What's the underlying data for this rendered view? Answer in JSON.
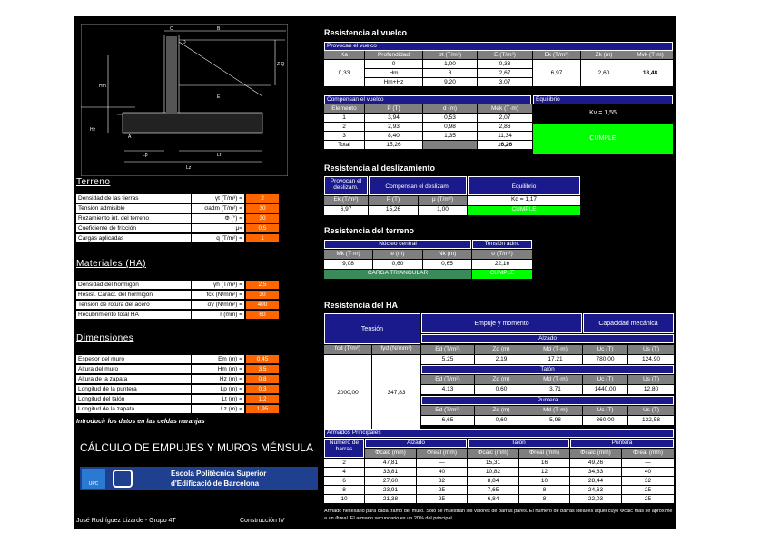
{
  "drawing": {
    "labels": {
      "c": "C",
      "b": "B",
      "a": "A",
      "d": "D",
      "e": "E",
      "hm": "Hm",
      "zq": "Z Q",
      "hz": "Hz",
      "lp": "Lp",
      "lt": "Lt",
      "lz": "Lz"
    }
  },
  "terreno": {
    "title": "Terreno",
    "rows": [
      {
        "label": "Densidad de las tierras",
        "symbol": "γt (T/m³) =",
        "value": "2"
      },
      {
        "label": "Tensión admisible",
        "symbol": "σadm (T/m²) =",
        "value": "30"
      },
      {
        "label": "Rozamiento int. del terreno",
        "symbol": "Φ (°) =",
        "value": "30"
      },
      {
        "label": "Coeficiente de fricción",
        "symbol": "μ=",
        "value": "0,5"
      },
      {
        "label": "Cargas aplicadas",
        "symbol": "q (T/m²) =",
        "value": "1"
      }
    ]
  },
  "materiales": {
    "title": "Materiales (HA)",
    "rows": [
      {
        "label": "Densidad del hormigón",
        "symbol": "γh (T/m³) =",
        "value": "2,5"
      },
      {
        "label": "Resist. Caract. del hormigón",
        "symbol": "fck (N/mm²) =",
        "value": "30"
      },
      {
        "label": "Tensión de rotura del acero",
        "symbol": "σy (N/mm²) =",
        "value": "400"
      },
      {
        "label": "Recubrimiento total HA",
        "symbol": "r (mm) =",
        "value": "60"
      }
    ]
  },
  "dimensiones": {
    "title": "Dimensiones",
    "rows": [
      {
        "label": "Espesor del muro",
        "symbol": "Em (m) =",
        "value": "0,45"
      },
      {
        "label": "Altura del muro",
        "symbol": "Hm (m) =",
        "value": "3,5"
      },
      {
        "label": "Altura de la zapata",
        "symbol": "Hz (m) =",
        "value": "0,8"
      },
      {
        "label": "Longitud de la puntera",
        "symbol": "Lp (m) =",
        "value": "0,3"
      },
      {
        "label": "Longitud del talón",
        "symbol": "Lt (m) =",
        "value": "1,2"
      },
      {
        "label": "Longitud de la zapata",
        "symbol": "Lz (m) =",
        "value": "1,95"
      }
    ],
    "note": "Introducir los datos en las celdas naranjas"
  },
  "big_title": "CÁLCULO DE EMPUJES Y MUROS MÉNSULA",
  "logo": {
    "short": "UPC",
    "line1": "Escola Politècnica Superior",
    "line2": "d'Edificació de Barcelona"
  },
  "footer": {
    "author": "José Rodríguez Lizarde - Grupo 4T",
    "course": "Construcción IV"
  },
  "vuelco": {
    "title": "Resistencia al vuelco",
    "provocan": "Provocan el vuelco",
    "h": [
      "Ka",
      "Profundidad",
      "σt (T/m²)",
      "E (T/m²)",
      "Ek (T/m²)",
      "Zk (m)",
      "Mvk (T·m)"
    ],
    "ka": "0,33",
    "rows": [
      [
        "0",
        "1,00",
        "0,33"
      ],
      [
        "Hm",
        "8",
        "2,67"
      ],
      [
        "Hm+Hz",
        "9,20",
        "3,07"
      ]
    ],
    "ek": "6,97",
    "zk": "2,60",
    "mvk": "18,48",
    "compensan": "Compensan el vuelco",
    "equilibrio": "Equilibrio",
    "h2": [
      "Elemento",
      "P (T)",
      "d (m)",
      "Mek (T·m)"
    ],
    "rows2": [
      [
        "1",
        "3,94",
        "0,53",
        "2,07"
      ],
      [
        "2",
        "2,93",
        "0,98",
        "2,86"
      ],
      [
        "3",
        "8,40",
        "1,35",
        "11,34"
      ],
      [
        "Total",
        "15,26",
        "",
        "16,26"
      ]
    ],
    "kv": "Kv = 1,55",
    "cumple": "CUMPLE"
  },
  "deslizamiento": {
    "title": "Resistencia al deslizamiento",
    "h": [
      "Provocan el deslizam.",
      "Compensan el deslizam.",
      "Equilibrio"
    ],
    "sub": [
      "Ek (T/m²)",
      "P (T)",
      "μ (T/m²)"
    ],
    "vals": [
      "6,97",
      "15,26",
      "1,00"
    ],
    "kd": "Kd = 1,17",
    "cumple": "CUMPLE"
  },
  "terreno_res": {
    "title": "Resistencia del terreno",
    "h": [
      "Núcleo central",
      "Tensión adm."
    ],
    "sub": [
      "Mk (T·m)",
      "e (m)",
      "Nk (m)",
      "σ (T/m²)"
    ],
    "vals": [
      "9,08",
      "0,60",
      "0,65",
      "22,16"
    ],
    "carga": "CARGA TRIANGULAR",
    "cumple": "CUMPLE"
  },
  "ha": {
    "title": "Resistencia del HA",
    "tension": "Tensión",
    "empuje": "Empuje y momento",
    "capacidad": "Capacidad mecánica",
    "alzado": "Alzado",
    "talon": "Talón",
    "puntera": "Puntera",
    "fh": [
      "fcd (T/m²)",
      "fyd (N/mm²)"
    ],
    "sub": [
      "Ed (T/m²)",
      "Zd (m)",
      "Md (T·m)",
      "Uc (T)",
      "Us (T)"
    ],
    "fcd": "2000,00",
    "fyd": "347,83",
    "alz": [
      "5,25",
      "2,19",
      "17,21",
      "780,00",
      "124,90"
    ],
    "tal": [
      "4,13",
      "0,60",
      "3,71",
      "1440,00",
      "12,80"
    ],
    "pun": [
      "6,65",
      "0,60",
      "5,98",
      "360,00",
      "132,58"
    ]
  },
  "armados": {
    "title": "Armados Principales",
    "h0": "Número de barras",
    "groups": [
      "Alzado",
      "Talón",
      "Puntera"
    ],
    "sub": [
      "Φcalc (mm)",
      "Φreal (mm)"
    ],
    "rows": [
      [
        "2",
        "47,81",
        "—",
        "15,31",
        "16",
        "49,26",
        "—"
      ],
      [
        "4",
        "33,81",
        "40",
        "10,82",
        "12",
        "34,83",
        "40"
      ],
      [
        "6",
        "27,60",
        "32",
        "8,84",
        "10",
        "28,44",
        "32"
      ],
      [
        "8",
        "23,91",
        "25",
        "7,65",
        "8",
        "24,63",
        "25"
      ],
      [
        "10",
        "21,38",
        "25",
        "6,84",
        "8",
        "22,03",
        "25"
      ]
    ],
    "note": "Armado necesario para cada tramo del muro. Sólo se muestran los valores de barras pares. El número de barras ideal es aquel cuyo Φcalc más se aproxime a un Φreal. El armado secundario es un 20% del principal."
  }
}
